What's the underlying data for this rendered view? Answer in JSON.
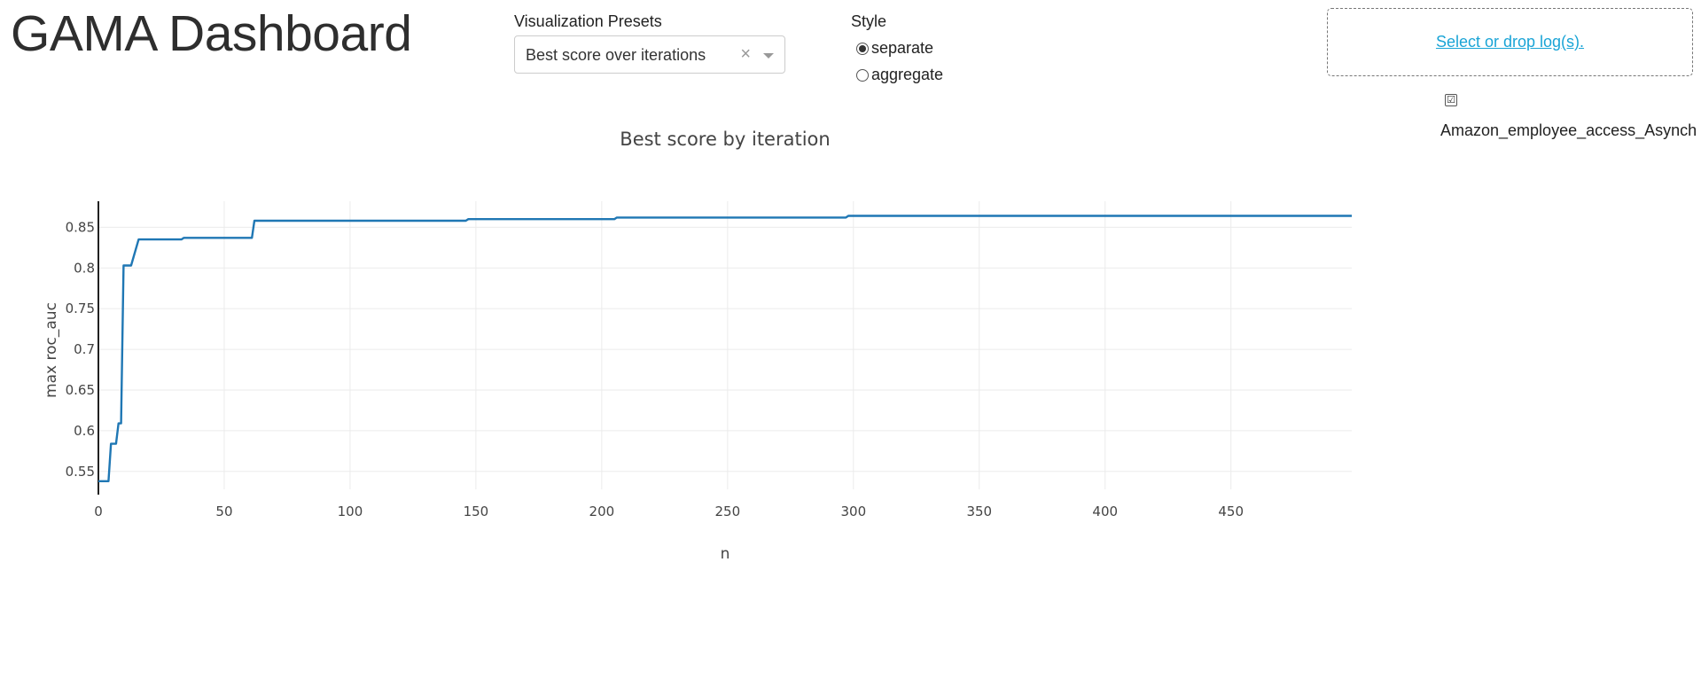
{
  "header": {
    "title": "GAMA Dashboard"
  },
  "presets": {
    "label": "Visualization Presets",
    "selected": "Best score over iterations",
    "clear_glyph": "×"
  },
  "style": {
    "label": "Style",
    "options": [
      {
        "label": "separate",
        "checked": true
      },
      {
        "label": "aggregate",
        "checked": false
      }
    ]
  },
  "upload": {
    "link_text": "Select or drop log(s)."
  },
  "logs": [
    {
      "label": "Amazon_employee_access_Asynch",
      "checked": true,
      "check_glyph": "☑"
    }
  ],
  "chart_data": {
    "type": "line",
    "title": "Best score by iteration",
    "xlabel": "n",
    "ylabel": "max roc_auc",
    "xlim": [
      0,
      498
    ],
    "ylim": [
      0.528,
      0.882
    ],
    "x_ticks": [
      0,
      50,
      100,
      150,
      200,
      250,
      300,
      350,
      400,
      450
    ],
    "y_ticks": [
      0.55,
      0.6,
      0.65,
      0.7,
      0.75,
      0.8,
      0.85
    ],
    "y_tick_labels": [
      "0.55",
      "0.6",
      "0.65",
      "0.7",
      "0.75",
      "0.8",
      "0.85"
    ],
    "grid": true,
    "line_color": "#1f77b4",
    "series": [
      {
        "x": [
          0,
          4,
          5,
          7,
          8,
          9,
          10,
          11,
          13,
          16,
          33,
          34,
          61,
          62,
          146,
          147,
          205,
          206,
          297,
          298,
          498
        ],
        "y": [
          0.538,
          0.538,
          0.584,
          0.584,
          0.609,
          0.609,
          0.803,
          0.803,
          0.803,
          0.835,
          0.835,
          0.837,
          0.837,
          0.858,
          0.858,
          0.86,
          0.86,
          0.862,
          0.862,
          0.864,
          0.864
        ]
      }
    ]
  }
}
